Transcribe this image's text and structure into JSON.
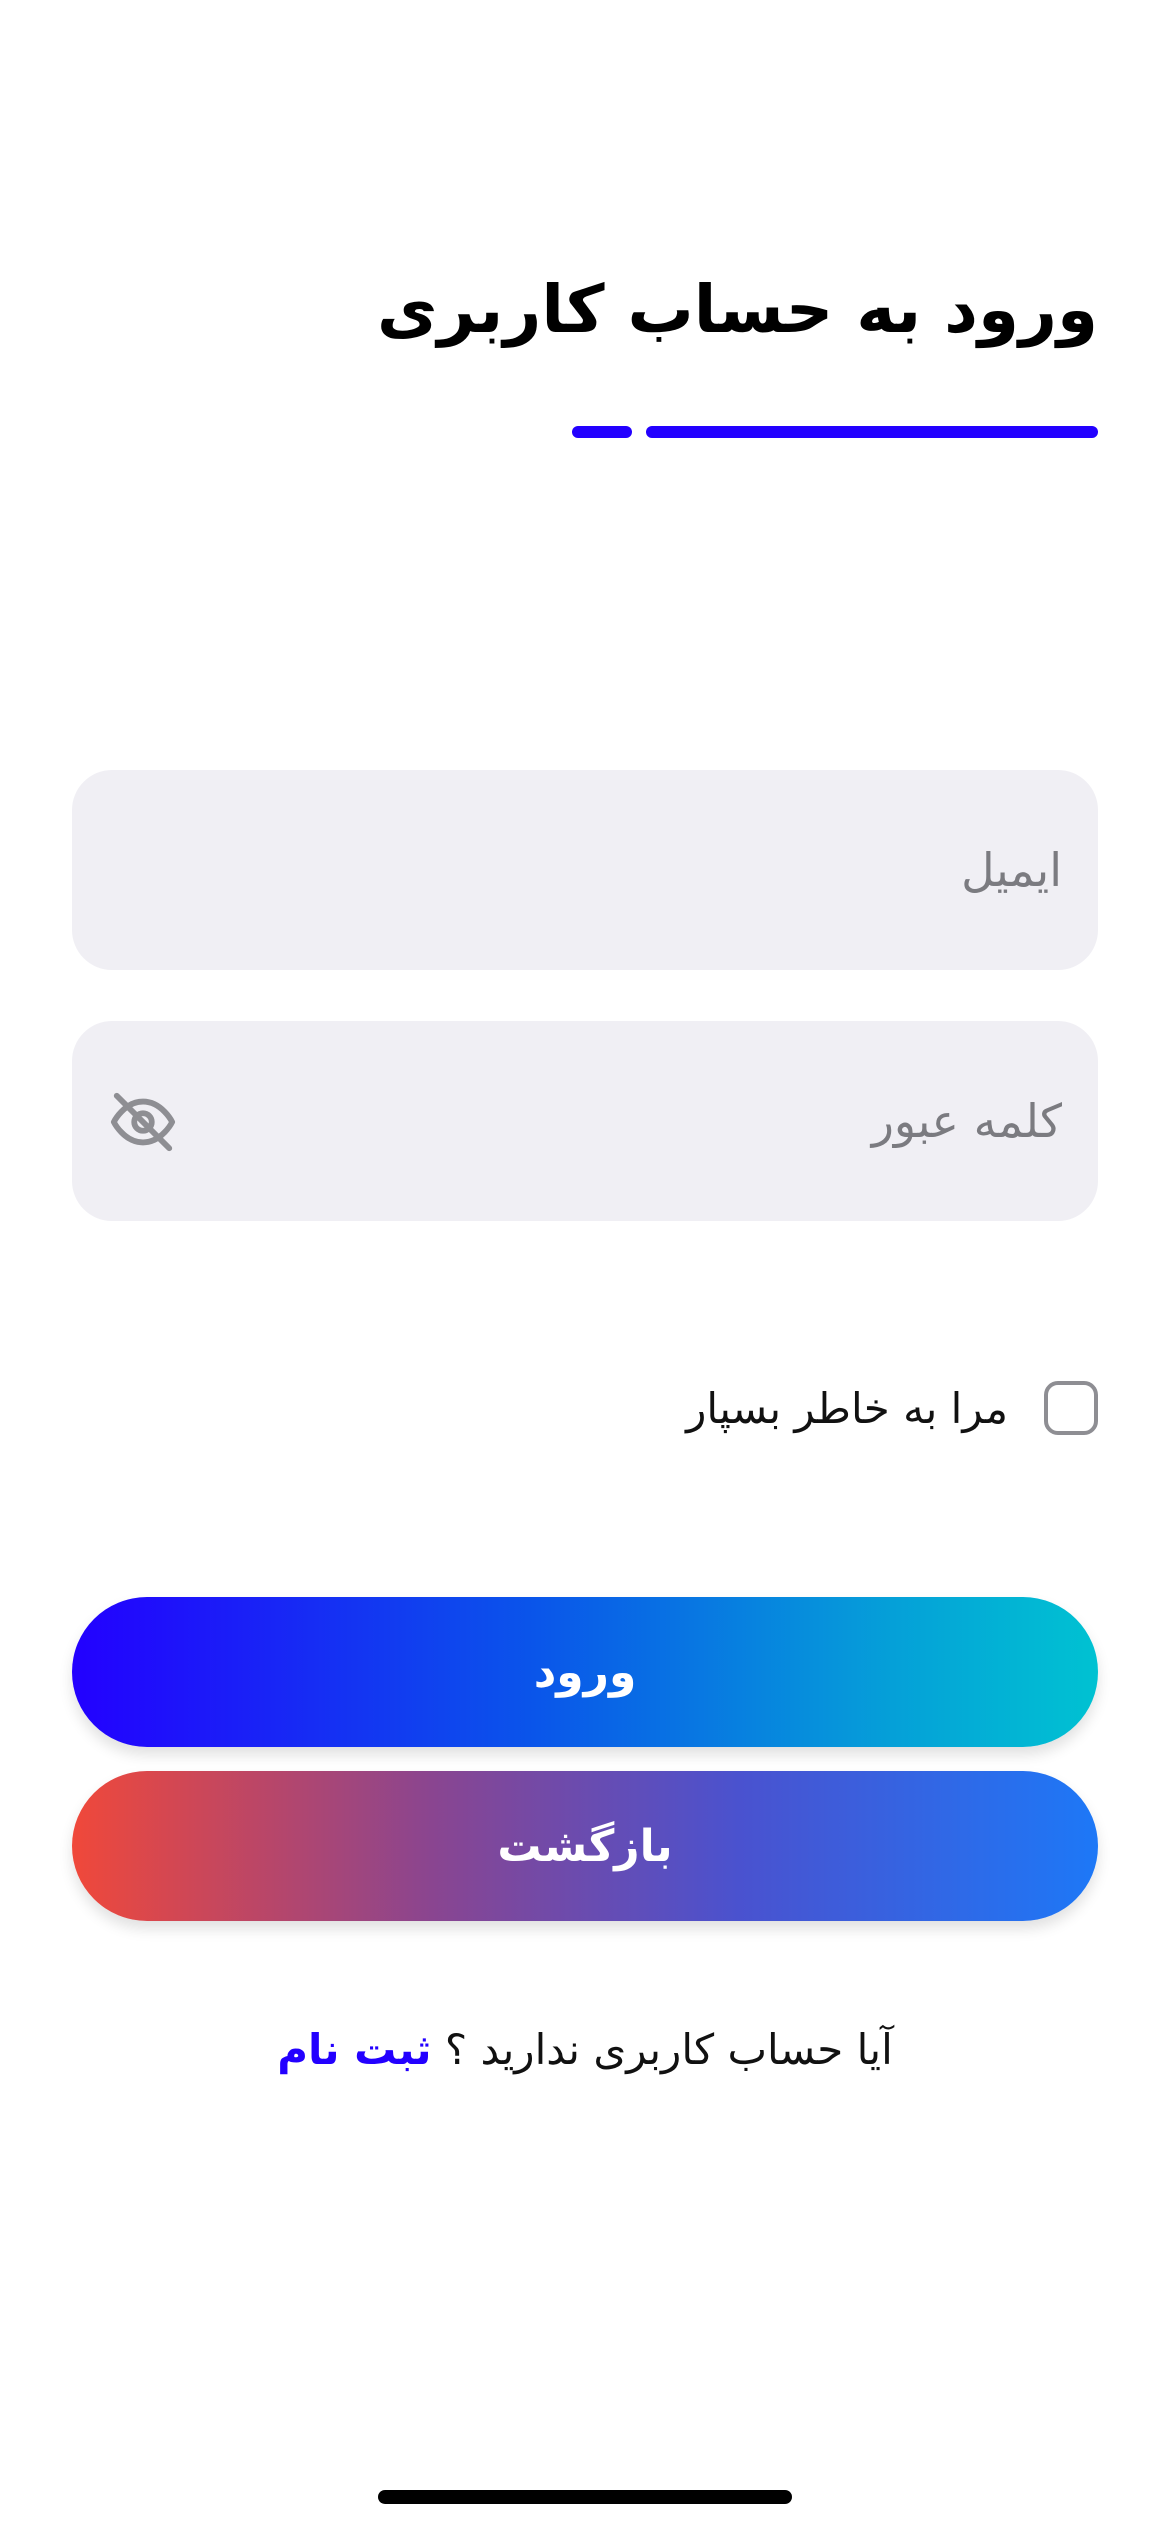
{
  "header": {
    "title": "ورود به حساب کاربری"
  },
  "form": {
    "email_placeholder": "ایمیل",
    "email_value": "",
    "password_placeholder": "کلمه عبور",
    "password_value": "",
    "password_toggle_icon": "eye-off-icon",
    "remember_label": "مرا به خاطر بسپار",
    "remember_checked": false
  },
  "actions": {
    "login_label": "ورود",
    "back_label": "بازگشت"
  },
  "footer": {
    "question": "آیا حساب کاربری ندارید ؟",
    "signup_label": "ثبت نام"
  },
  "colors": {
    "accent": "#2300ff",
    "field_background": "#f0eff4",
    "placeholder": "#7b7b80",
    "checkbox_border": "#8e8e93"
  }
}
